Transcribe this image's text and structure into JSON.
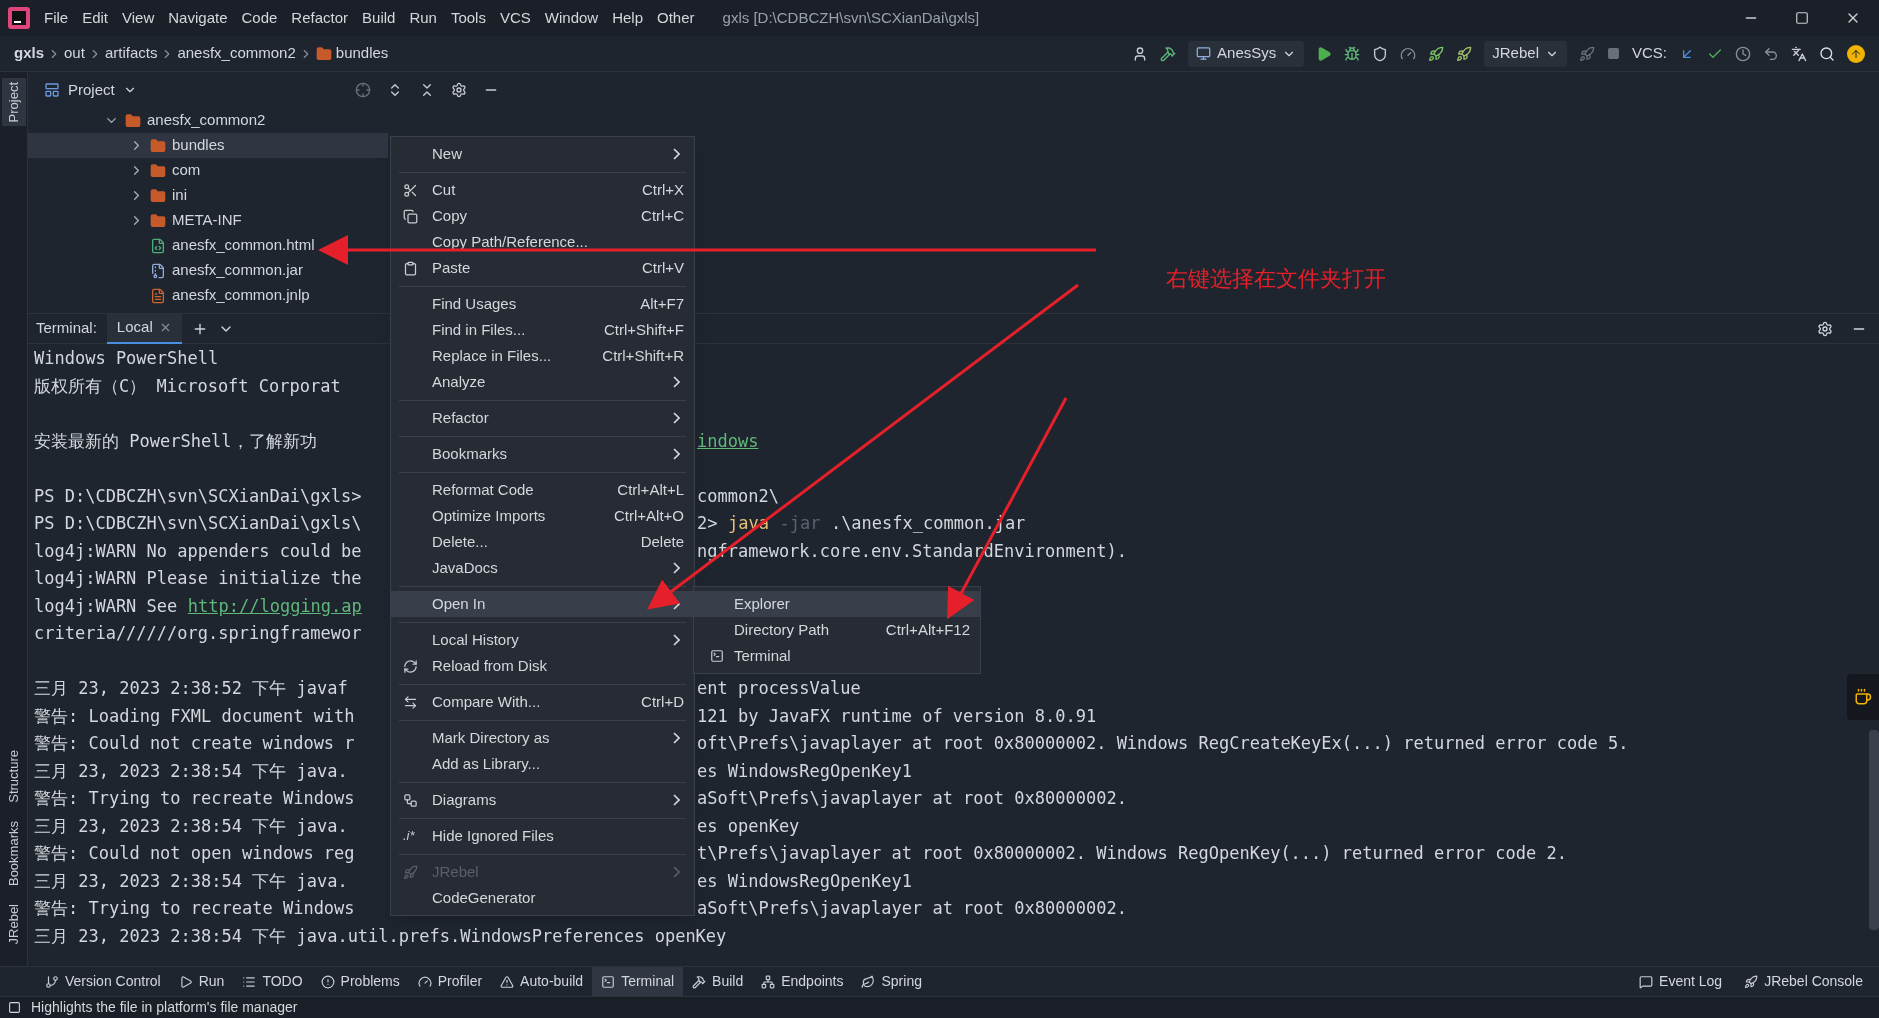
{
  "menu_bar": {
    "menus": [
      "File",
      "Edit",
      "View",
      "Navigate",
      "Code",
      "Refactor",
      "Build",
      "Run",
      "Tools",
      "VCS",
      "Window",
      "Help",
      "Other"
    ],
    "title": "gxls [D:\\CDBCZH\\svn\\SCXianDai\\gxls]"
  },
  "breadcrumbs": [
    "gxls",
    "out",
    "artifacts",
    "anesfx_common2",
    "bundles"
  ],
  "toolbar": {
    "run_config": "AnesSys",
    "jrebel_config": "JRebel",
    "vcs_label": "VCS:"
  },
  "side_strip": [
    {
      "label": "Project",
      "selected": true
    },
    {
      "label": "Structure",
      "selected": false
    },
    {
      "label": "Bookmarks",
      "selected": false
    },
    {
      "label": "JRebel",
      "selected": false
    }
  ],
  "project": {
    "title": "Project",
    "tree": {
      "label": "anesfx_common2",
      "expanded": true,
      "children": [
        {
          "label": "bundles",
          "kind": "folder",
          "expanded": false,
          "selected": true
        },
        {
          "label": "com",
          "kind": "folder",
          "expanded": false,
          "selected": false
        },
        {
          "label": "ini",
          "kind": "folder",
          "expanded": false,
          "selected": false
        },
        {
          "label": "META-INF",
          "kind": "folder",
          "expanded": false,
          "selected": false
        },
        {
          "label": "anesfx_common.html",
          "kind": "html",
          "selected": false
        },
        {
          "label": "anesfx_common.jar",
          "kind": "jar",
          "selected": false
        },
        {
          "label": "anesfx_common.jnlp",
          "kind": "jnlp",
          "selected": false
        }
      ]
    }
  },
  "terminal": {
    "label": "Terminal:",
    "tabs": [
      {
        "label": "Local",
        "selected": true
      }
    ],
    "lines": [
      {
        "kind": "text",
        "left": [
          {
            "text": "Windows PowerShell",
            "kind": "plain"
          }
        ]
      },
      {
        "kind": "text",
        "left": [
          {
            "text": "版权所有（C） Microsoft Corporat",
            "kind": "plain"
          }
        ]
      },
      {
        "kind": "blank"
      },
      {
        "kind": "text",
        "left": [
          {
            "text": "安装最新的 PowerShell，了解新功",
            "kind": "plain"
          }
        ],
        "right": [
          {
            "text": "indows",
            "kind": "link"
          }
        ]
      },
      {
        "kind": "blank"
      },
      {
        "kind": "text",
        "left": [
          {
            "text": "PS D:\\CDBCZH\\svn\\SCXianDai\\gxls>",
            "kind": "plain"
          }
        ],
        "right": [
          {
            "text": "common2\\",
            "kind": "plain"
          }
        ]
      },
      {
        "kind": "text",
        "left": [
          {
            "text": "PS D:\\CDBCZH\\svn\\SCXianDai\\gxls\\",
            "kind": "plain"
          }
        ],
        "right": [
          {
            "text": "2>",
            "kind": "plain"
          },
          {
            "text": "java",
            "kind": "command"
          },
          {
            "text": "-jar",
            "kind": "flag"
          },
          {
            "text": ".\\anesfx_common.jar",
            "kind": "plain"
          }
        ]
      },
      {
        "kind": "text",
        "left": [
          {
            "text": "log4j:WARN No appenders could be",
            "kind": "plain"
          }
        ],
        "right": [
          {
            "text": "ngframework.core.env.StandardEnvironment).",
            "kind": "plain"
          }
        ]
      },
      {
        "kind": "text",
        "left": [
          {
            "text": "log4j:WARN Please initialize the",
            "kind": "plain"
          }
        ]
      },
      {
        "kind": "text",
        "left": [
          {
            "text": "log4j:WARN See",
            "kind": "plain"
          },
          {
            "text": "http://logging.ap",
            "kind": "link"
          }
        ]
      },
      {
        "kind": "text",
        "left": [
          {
            "text": "criteria//////org.springframewor",
            "kind": "plain"
          }
        ]
      },
      {
        "kind": "blank"
      },
      {
        "kind": "text",
        "left": [
          {
            "text": "三月 23, 2023 2:38:52 下午 javaf",
            "kind": "plain"
          }
        ],
        "right": [
          {
            "text": "ent processValue",
            "kind": "plain"
          }
        ]
      },
      {
        "kind": "text",
        "left": [
          {
            "text": "警告: Loading FXML document with",
            "kind": "plain"
          }
        ],
        "right": [
          {
            "text": "121 by JavaFX runtime of version 8.0.91",
            "kind": "plain"
          }
        ]
      },
      {
        "kind": "text",
        "left": [
          {
            "text": "警告: Could not create windows r",
            "kind": "plain"
          }
        ],
        "right": [
          {
            "text": "oft\\Prefs\\javaplayer at root 0x80000002. Windows RegCreateKeyEx(...) returned error code 5.",
            "kind": "plain"
          }
        ]
      },
      {
        "kind": "text",
        "left": [
          {
            "text": "三月 23, 2023 2:38:54 下午 java.",
            "kind": "plain"
          }
        ],
        "right": [
          {
            "text": "es WindowsRegOpenKey1",
            "kind": "plain"
          }
        ]
      },
      {
        "kind": "text",
        "left": [
          {
            "text": "警告: Trying to recreate Windows",
            "kind": "plain"
          }
        ],
        "right": [
          {
            "text": "aSoft\\Prefs\\javaplayer at root 0x80000002.",
            "kind": "plain"
          }
        ]
      },
      {
        "kind": "text",
        "left": [
          {
            "text": "三月 23, 2023 2:38:54 下午 java.",
            "kind": "plain"
          }
        ],
        "right": [
          {
            "text": "es openKey",
            "kind": "plain"
          }
        ]
      },
      {
        "kind": "text",
        "left": [
          {
            "text": "警告: Could not open windows reg",
            "kind": "plain"
          }
        ],
        "right": [
          {
            "text": "t\\Prefs\\javaplayer at root 0x80000002. Windows RegOpenKey(...) returned error code 2.",
            "kind": "plain"
          }
        ]
      },
      {
        "kind": "text",
        "left": [
          {
            "text": "三月 23, 2023 2:38:54 下午 java.",
            "kind": "plain"
          }
        ],
        "right": [
          {
            "text": "es WindowsRegOpenKey1",
            "kind": "plain"
          }
        ]
      },
      {
        "kind": "text",
        "left": [
          {
            "text": "警告: Trying to recreate Windows",
            "kind": "plain"
          }
        ],
        "right": [
          {
            "text": "aSoft\\Prefs\\javaplayer at root 0x80000002.",
            "kind": "plain"
          }
        ]
      },
      {
        "kind": "text",
        "left": [
          {
            "text": "三月 23, 2023 2:38:54 下午 java.util.prefs.WindowsPreferences openKey",
            "kind": "plain"
          }
        ]
      }
    ]
  },
  "context_menu": {
    "groups": [
      [
        {
          "label": "New",
          "submenu": true,
          "selected": false,
          "disabled": false
        }
      ],
      [
        {
          "label": "Cut",
          "shortcut": "Ctrl+X",
          "submenu": false,
          "selected": false,
          "disabled": false
        },
        {
          "label": "Copy",
          "shortcut": "Ctrl+C",
          "submenu": false,
          "selected": false,
          "disabled": false
        },
        {
          "label": "Copy Path/Reference...",
          "submenu": false,
          "selected": false,
          "disabled": false
        },
        {
          "label": "Paste",
          "shortcut": "Ctrl+V",
          "submenu": false,
          "selected": false,
          "disabled": false
        }
      ],
      [
        {
          "label": "Find Usages",
          "shortcut": "Alt+F7",
          "submenu": false,
          "selected": false,
          "disabled": false
        },
        {
          "label": "Find in Files...",
          "shortcut": "Ctrl+Shift+F",
          "submenu": false,
          "selected": false,
          "disabled": false
        },
        {
          "label": "Replace in Files...",
          "shortcut": "Ctrl+Shift+R",
          "submenu": false,
          "selected": false,
          "disabled": false
        },
        {
          "label": "Analyze",
          "submenu": true,
          "selected": false,
          "disabled": false
        }
      ],
      [
        {
          "label": "Refactor",
          "submenu": true,
          "selected": false,
          "disabled": false
        }
      ],
      [
        {
          "label": "Bookmarks",
          "submenu": true,
          "selected": false,
          "disabled": false
        }
      ],
      [
        {
          "label": "Reformat Code",
          "shortcut": "Ctrl+Alt+L",
          "submenu": false,
          "selected": false,
          "disabled": false
        },
        {
          "label": "Optimize Imports",
          "shortcut": "Ctrl+Alt+O",
          "submenu": false,
          "selected": false,
          "disabled": false
        },
        {
          "label": "Delete...",
          "shortcut": "Delete",
          "submenu": false,
          "selected": false,
          "disabled": false
        },
        {
          "label": "JavaDocs",
          "submenu": true,
          "selected": false,
          "disabled": false
        }
      ],
      [
        {
          "label": "Open In",
          "submenu": true,
          "selected": true,
          "disabled": false
        }
      ],
      [
        {
          "label": "Local History",
          "submenu": true,
          "selected": false,
          "disabled": false
        },
        {
          "label": "Reload from Disk",
          "submenu": false,
          "selected": false,
          "disabled": false
        }
      ],
      [
        {
          "label": "Compare With...",
          "shortcut": "Ctrl+D",
          "submenu": false,
          "selected": false,
          "disabled": false
        }
      ],
      [
        {
          "label": "Mark Directory as",
          "submenu": true,
          "selected": false,
          "disabled": false
        },
        {
          "label": "Add as Library...",
          "submenu": false,
          "selected": false,
          "disabled": false
        }
      ],
      [
        {
          "label": "Diagrams",
          "submenu": true,
          "selected": false,
          "disabled": false
        }
      ],
      [
        {
          "label": "Hide Ignored Files",
          "icon_text": ".i*",
          "submenu": false,
          "selected": false,
          "disabled": false
        }
      ],
      [
        {
          "label": "JRebel",
          "submenu": true,
          "selected": false,
          "disabled": true
        },
        {
          "label": "CodeGenerator",
          "submenu": false,
          "selected": false,
          "disabled": false
        }
      ]
    ]
  },
  "open_in_submenu": [
    {
      "label": "Explorer",
      "selected": true
    },
    {
      "label": "Directory Path",
      "shortcut": "Ctrl+Alt+F12",
      "selected": false
    },
    {
      "label": "Terminal",
      "selected": false
    }
  ],
  "annotation": {
    "text": "右键选择在文件夹打开"
  },
  "tool_windows": [
    {
      "label": "Version Control",
      "selected": false
    },
    {
      "label": "Run",
      "selected": false
    },
    {
      "label": "TODO",
      "selected": false
    },
    {
      "label": "Problems",
      "selected": false
    },
    {
      "label": "Profiler",
      "selected": false
    },
    {
      "label": "Auto-build",
      "selected": false
    },
    {
      "label": "Terminal",
      "selected": true
    },
    {
      "label": "Build",
      "selected": false
    },
    {
      "label": "Endpoints",
      "selected": false
    },
    {
      "label": "Spring",
      "selected": false
    }
  ],
  "tool_windows_right": [
    "Event Log",
    "JRebel Console"
  ],
  "status_bar": {
    "message": "Highlights the file in platform's file manager"
  }
}
